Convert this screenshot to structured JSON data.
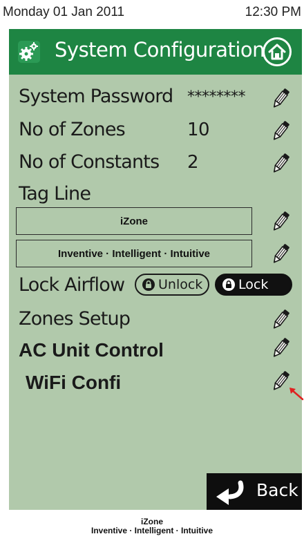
{
  "status_bar": {
    "date": "Monday 01 Jan 2011",
    "time": "12:30 PM"
  },
  "header": {
    "title": "System Configuration",
    "left_icon": "settings-gear-icon",
    "right_icon": "home-icon"
  },
  "settings": {
    "system_password": {
      "label": "System Password",
      "value": "********"
    },
    "no_of_zones": {
      "label": "No of Zones",
      "value": "10"
    },
    "no_of_constants": {
      "label": "No of Constants",
      "value": "2"
    },
    "tag_line": {
      "label": "Tag Line",
      "line1": "iZone",
      "line2": "Inventive · Intelligent · Intuitive"
    },
    "lock_airflow": {
      "label": "Lock Airflow",
      "unlock_label": "Unlock",
      "lock_label": "Lock",
      "selected": "Lock"
    },
    "zones_setup": {
      "label": "Zones Setup"
    },
    "ac_unit_control": {
      "label": "AC Unit Control"
    },
    "wifi_config": {
      "label": "WiFi Confi"
    }
  },
  "back_button": {
    "label": "Back"
  },
  "footer": {
    "line1": "iZone",
    "line2": "Inventive · Intelligent · Intuitive"
  },
  "colors": {
    "header_green": "#1e8543",
    "panel_green": "#b1c9ab",
    "back_button": "#0e0e0e",
    "annotation_arrow": "#e02020"
  }
}
